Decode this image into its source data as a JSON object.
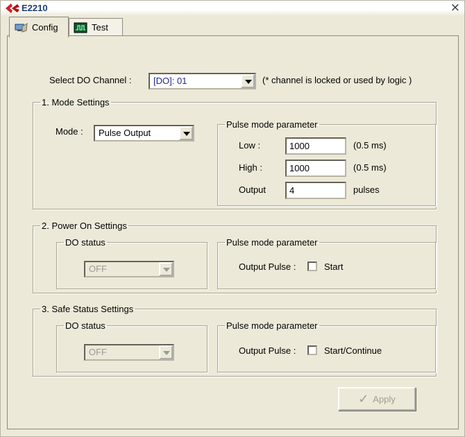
{
  "window": {
    "title": "E2210",
    "close_symbol": "×"
  },
  "tabs": [
    {
      "label": "Config",
      "icon": "config-icon",
      "active": true
    },
    {
      "label": "Test",
      "icon": "test-icon",
      "active": false
    }
  ],
  "config": {
    "channel_label": "Select DO Channel :",
    "channel_value": "[DO]: 01",
    "channel_note": "(* channel is locked or used by logic )",
    "mode_settings": {
      "title": "1. Mode Settings",
      "mode_label": "Mode :",
      "mode_value": "Pulse Output",
      "pulse_group_title": "Pulse mode parameter",
      "low_label": "Low :",
      "low_value": "1000",
      "low_unit": "(0.5 ms)",
      "high_label": "High :",
      "high_value": "1000",
      "high_unit": "(0.5 ms)",
      "output_label": "Output",
      "output_value": "4",
      "output_unit": "pulses"
    },
    "power_on_settings": {
      "title": "2. Power On Settings",
      "do_status_title": "DO status",
      "do_status_value": "OFF",
      "pulse_group_title": "Pulse mode parameter",
      "output_pulse_label": "Output Pulse :",
      "output_pulse_checkbox_label": "Start",
      "output_pulse_checked": false
    },
    "safe_status_settings": {
      "title": "3. Safe Status Settings",
      "do_status_title": "DO status",
      "do_status_value": "OFF",
      "pulse_group_title": "Pulse mode parameter",
      "output_pulse_label": "Output Pulse :",
      "output_pulse_checkbox_label": "Start/Continue",
      "output_pulse_checked": false
    },
    "apply_label": "Apply"
  }
}
